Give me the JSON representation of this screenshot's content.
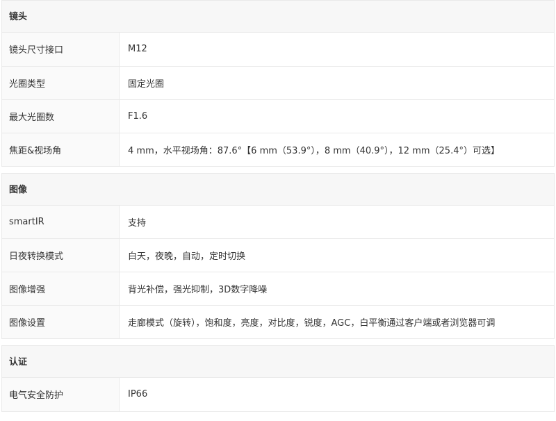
{
  "sections": [
    {
      "title": "镜头",
      "rows": [
        {
          "label": "镜头尺寸接口",
          "value": "M12"
        },
        {
          "label": "光圈类型",
          "value": "固定光圈"
        },
        {
          "label": "最大光圈数",
          "value": "F1.6"
        },
        {
          "label": "焦距&视场角",
          "value": "4 mm，水平视场角：87.6°【6 mm（53.9°），8 mm（40.9°），12 mm（25.4°）可选】"
        }
      ]
    },
    {
      "title": "图像",
      "rows": [
        {
          "label": "smartIR",
          "value": "支持"
        },
        {
          "label": "日夜转换模式",
          "value": "白天，夜晚，自动，定时切换"
        },
        {
          "label": "图像增强",
          "value": "背光补偿，强光抑制，3D数字降噪"
        },
        {
          "label": "图像设置",
          "value": "走廊模式（旋转），饱和度，亮度，对比度，锐度，AGC，白平衡通过客户端或者浏览器可调"
        }
      ]
    },
    {
      "title": "认证",
      "rows": [
        {
          "label": "电气安全防护",
          "value": "IP66"
        }
      ]
    }
  ]
}
